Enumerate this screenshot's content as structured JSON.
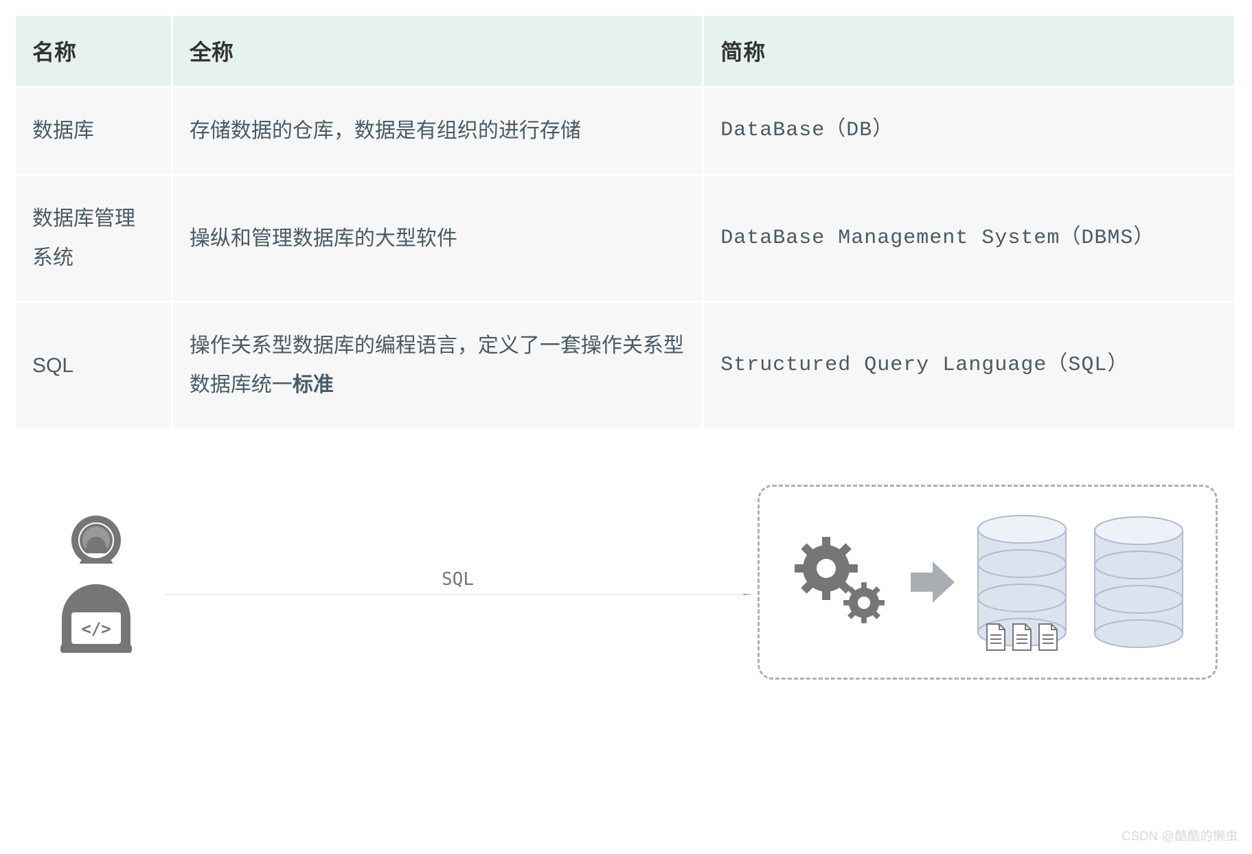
{
  "table": {
    "headers": {
      "name": "名称",
      "full": "全称",
      "abbr": "简称"
    },
    "rows": [
      {
        "name": "数据库",
        "full": "存储数据的仓库，数据是有组织的进行存储",
        "abbr": "DataBase（DB）"
      },
      {
        "name": "数据库管理系统",
        "full": "操纵和管理数据库的大型软件",
        "abbr": "DataBase Management System（DBMS）"
      },
      {
        "name": "SQL",
        "full_prefix": "操作关系型数据库的编程语言，定义了一套操作关系型数据库统一",
        "full_bold": "标准",
        "abbr": "Structured Query Language（SQL）"
      }
    ]
  },
  "diagram": {
    "arrow_label": "SQL"
  },
  "watermark": "CSDN @酷酷的懒虫"
}
